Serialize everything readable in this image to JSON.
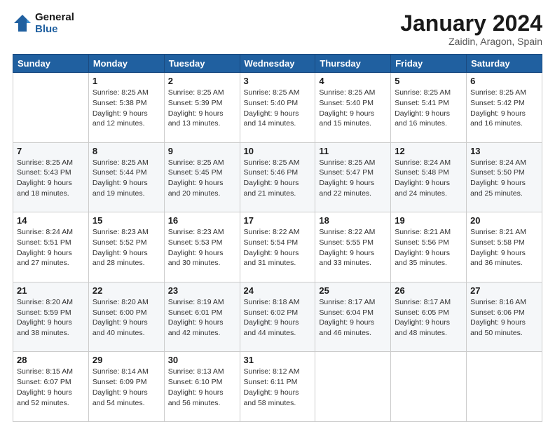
{
  "header": {
    "logo_line1": "General",
    "logo_line2": "Blue",
    "title": "January 2024",
    "subtitle": "Zaidin, Aragon, Spain"
  },
  "columns": [
    "Sunday",
    "Monday",
    "Tuesday",
    "Wednesday",
    "Thursday",
    "Friday",
    "Saturday"
  ],
  "weeks": [
    {
      "shaded": false,
      "days": [
        {
          "num": "",
          "detail": ""
        },
        {
          "num": "1",
          "detail": "Sunrise: 8:25 AM\nSunset: 5:38 PM\nDaylight: 9 hours\nand 12 minutes."
        },
        {
          "num": "2",
          "detail": "Sunrise: 8:25 AM\nSunset: 5:39 PM\nDaylight: 9 hours\nand 13 minutes."
        },
        {
          "num": "3",
          "detail": "Sunrise: 8:25 AM\nSunset: 5:40 PM\nDaylight: 9 hours\nand 14 minutes."
        },
        {
          "num": "4",
          "detail": "Sunrise: 8:25 AM\nSunset: 5:40 PM\nDaylight: 9 hours\nand 15 minutes."
        },
        {
          "num": "5",
          "detail": "Sunrise: 8:25 AM\nSunset: 5:41 PM\nDaylight: 9 hours\nand 16 minutes."
        },
        {
          "num": "6",
          "detail": "Sunrise: 8:25 AM\nSunset: 5:42 PM\nDaylight: 9 hours\nand 16 minutes."
        }
      ]
    },
    {
      "shaded": true,
      "days": [
        {
          "num": "7",
          "detail": "Sunrise: 8:25 AM\nSunset: 5:43 PM\nDaylight: 9 hours\nand 18 minutes."
        },
        {
          "num": "8",
          "detail": "Sunrise: 8:25 AM\nSunset: 5:44 PM\nDaylight: 9 hours\nand 19 minutes."
        },
        {
          "num": "9",
          "detail": "Sunrise: 8:25 AM\nSunset: 5:45 PM\nDaylight: 9 hours\nand 20 minutes."
        },
        {
          "num": "10",
          "detail": "Sunrise: 8:25 AM\nSunset: 5:46 PM\nDaylight: 9 hours\nand 21 minutes."
        },
        {
          "num": "11",
          "detail": "Sunrise: 8:25 AM\nSunset: 5:47 PM\nDaylight: 9 hours\nand 22 minutes."
        },
        {
          "num": "12",
          "detail": "Sunrise: 8:24 AM\nSunset: 5:48 PM\nDaylight: 9 hours\nand 24 minutes."
        },
        {
          "num": "13",
          "detail": "Sunrise: 8:24 AM\nSunset: 5:50 PM\nDaylight: 9 hours\nand 25 minutes."
        }
      ]
    },
    {
      "shaded": false,
      "days": [
        {
          "num": "14",
          "detail": "Sunrise: 8:24 AM\nSunset: 5:51 PM\nDaylight: 9 hours\nand 27 minutes."
        },
        {
          "num": "15",
          "detail": "Sunrise: 8:23 AM\nSunset: 5:52 PM\nDaylight: 9 hours\nand 28 minutes."
        },
        {
          "num": "16",
          "detail": "Sunrise: 8:23 AM\nSunset: 5:53 PM\nDaylight: 9 hours\nand 30 minutes."
        },
        {
          "num": "17",
          "detail": "Sunrise: 8:22 AM\nSunset: 5:54 PM\nDaylight: 9 hours\nand 31 minutes."
        },
        {
          "num": "18",
          "detail": "Sunrise: 8:22 AM\nSunset: 5:55 PM\nDaylight: 9 hours\nand 33 minutes."
        },
        {
          "num": "19",
          "detail": "Sunrise: 8:21 AM\nSunset: 5:56 PM\nDaylight: 9 hours\nand 35 minutes."
        },
        {
          "num": "20",
          "detail": "Sunrise: 8:21 AM\nSunset: 5:58 PM\nDaylight: 9 hours\nand 36 minutes."
        }
      ]
    },
    {
      "shaded": true,
      "days": [
        {
          "num": "21",
          "detail": "Sunrise: 8:20 AM\nSunset: 5:59 PM\nDaylight: 9 hours\nand 38 minutes."
        },
        {
          "num": "22",
          "detail": "Sunrise: 8:20 AM\nSunset: 6:00 PM\nDaylight: 9 hours\nand 40 minutes."
        },
        {
          "num": "23",
          "detail": "Sunrise: 8:19 AM\nSunset: 6:01 PM\nDaylight: 9 hours\nand 42 minutes."
        },
        {
          "num": "24",
          "detail": "Sunrise: 8:18 AM\nSunset: 6:02 PM\nDaylight: 9 hours\nand 44 minutes."
        },
        {
          "num": "25",
          "detail": "Sunrise: 8:17 AM\nSunset: 6:04 PM\nDaylight: 9 hours\nand 46 minutes."
        },
        {
          "num": "26",
          "detail": "Sunrise: 8:17 AM\nSunset: 6:05 PM\nDaylight: 9 hours\nand 48 minutes."
        },
        {
          "num": "27",
          "detail": "Sunrise: 8:16 AM\nSunset: 6:06 PM\nDaylight: 9 hours\nand 50 minutes."
        }
      ]
    },
    {
      "shaded": false,
      "days": [
        {
          "num": "28",
          "detail": "Sunrise: 8:15 AM\nSunset: 6:07 PM\nDaylight: 9 hours\nand 52 minutes."
        },
        {
          "num": "29",
          "detail": "Sunrise: 8:14 AM\nSunset: 6:09 PM\nDaylight: 9 hours\nand 54 minutes."
        },
        {
          "num": "30",
          "detail": "Sunrise: 8:13 AM\nSunset: 6:10 PM\nDaylight: 9 hours\nand 56 minutes."
        },
        {
          "num": "31",
          "detail": "Sunrise: 8:12 AM\nSunset: 6:11 PM\nDaylight: 9 hours\nand 58 minutes."
        },
        {
          "num": "",
          "detail": ""
        },
        {
          "num": "",
          "detail": ""
        },
        {
          "num": "",
          "detail": ""
        }
      ]
    }
  ]
}
